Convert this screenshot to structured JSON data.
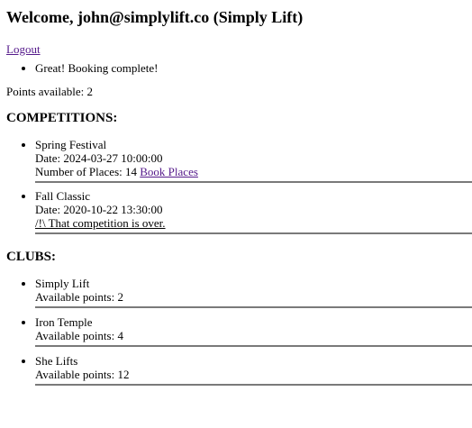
{
  "header": {
    "welcome": "Welcome, john@simplylift.co (Simply Lift)"
  },
  "nav": {
    "logout_label": "Logout"
  },
  "messages": [
    "Great! Booking complete!"
  ],
  "points": {
    "text": "Points available: 2"
  },
  "competitions": {
    "title": "COMPETITIONS:",
    "items": [
      {
        "name": "Spring Festival",
        "date": "Date: 2024-03-27 10:00:00",
        "places": "Number of Places: 14",
        "book_label": "Book Places"
      },
      {
        "name": "Fall Classic",
        "date": "Date: 2020-10-22 13:30:00",
        "over_message": "/!\\ That competition is over."
      }
    ]
  },
  "clubs": {
    "title": "CLUBS:",
    "items": [
      {
        "name": "Simply Lift",
        "points": "Available points: 2"
      },
      {
        "name": "Iron Temple",
        "points": "Available points: 4"
      },
      {
        "name": "She Lifts",
        "points": "Available points: 12"
      }
    ]
  }
}
